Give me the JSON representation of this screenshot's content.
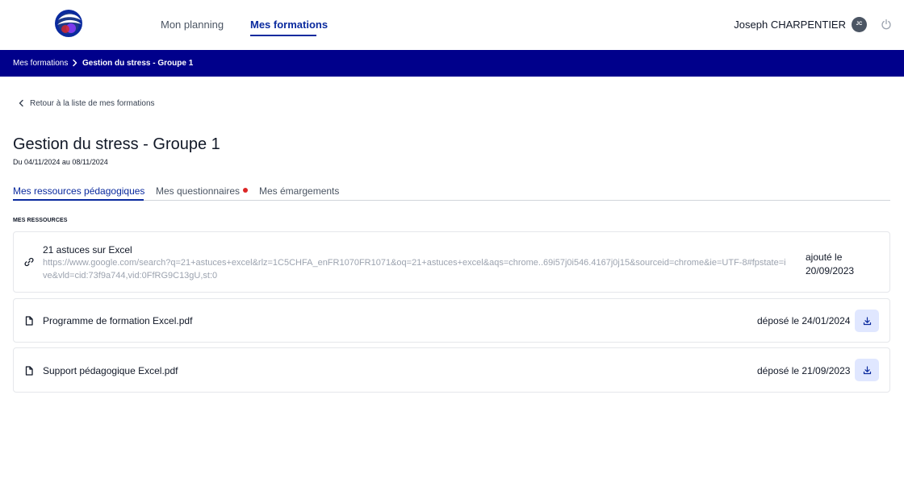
{
  "header": {
    "nav": [
      {
        "label": "Mon planning"
      },
      {
        "label": "Mes formations",
        "active": true
      }
    ],
    "user_name": "Joseph CHARPENTIER",
    "avatar_initials": "JC",
    "accent_color": "#0a2a9e"
  },
  "breadcrumb": {
    "items": [
      "Mes formations",
      "Gestion du stress - Groupe 1"
    ],
    "bar_color": "#00008b"
  },
  "back_link": "Retour à la liste de mes formations",
  "page": {
    "title": "Gestion du stress - Groupe 1",
    "dates": "Du 04/11/2024 au 08/11/2024"
  },
  "tabs": [
    {
      "label": "Mes ressources pédagogiques",
      "active": true
    },
    {
      "label": "Mes questionnaires",
      "badge": "red-dot"
    },
    {
      "label": "Mes émargements"
    }
  ],
  "section_label": "MES RESSOURCES",
  "resources": [
    {
      "icon": "link-icon",
      "title": "21 astuces sur Excel",
      "url": "https://www.google.com/search?q=21+astuces+excel&rlz=1C5CHFA_enFR1070FR1071&oq=21+astuces+excel&aqs=chrome..69i57j0i546.4167j0j15&sourceid=chrome&ie=UTF-8#fpstate=ive&vld=cid:73f9a744,vid:0FfRG9C13gU,st:0",
      "date_label": "ajouté le",
      "date": "20/09/2023"
    },
    {
      "icon": "file-icon",
      "title": "Programme de formation Excel.pdf",
      "date_text": "déposé le 24/01/2024",
      "action_icon": "download-icon"
    },
    {
      "icon": "file-icon",
      "title": "Support pédagogique Excel.pdf",
      "date_text": "déposé le 21/09/2023",
      "action_icon": "download-icon"
    }
  ]
}
